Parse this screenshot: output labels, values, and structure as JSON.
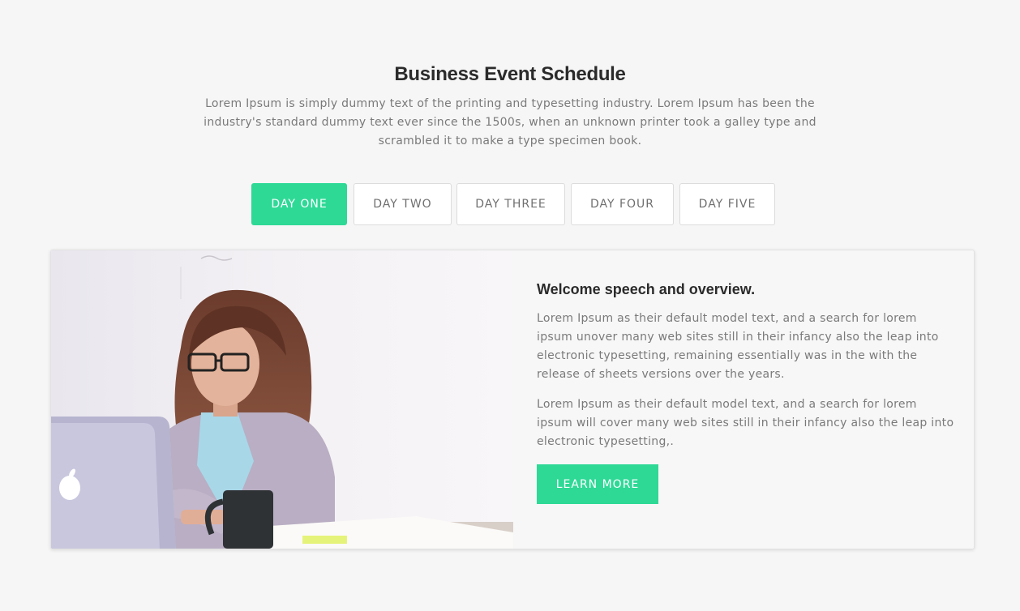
{
  "section": {
    "title": "Business Event Schedule",
    "intro": "Lorem Ipsum is simply dummy text of the printing and typesetting industry. Lorem Ipsum has been the industry's standard dummy text ever since the 1500s, when an unknown printer took a galley type and scrambled it to make a type specimen book."
  },
  "tabs": [
    {
      "label": "DAY ONE",
      "active": true
    },
    {
      "label": "DAY TWO",
      "active": false
    },
    {
      "label": "DAY THREE",
      "active": false
    },
    {
      "label": "DAY FOUR",
      "active": false
    },
    {
      "label": "DAY FIVE",
      "active": false
    }
  ],
  "event": {
    "title": "Welcome speech and overview.",
    "paragraphs": [
      "Lorem Ipsum as their default model text, and a search for lorem ipsum unover many web sites still in their infancy also the leap into electronic typesetting, remaining essentially was in the with the release of sheets versions over the years.",
      "Lorem Ipsum as their default model text, and a search for lorem ipsum will cover many web sites still in their infancy also the leap into electronic typesetting,."
    ],
    "button_label": "LEARN MORE",
    "photo_icon": "woman-at-laptop-photo"
  },
  "colors": {
    "accent": "#2ed996",
    "background": "#f6f6f6",
    "heading": "#2b2b2b",
    "body_text": "#7a7a7a"
  }
}
